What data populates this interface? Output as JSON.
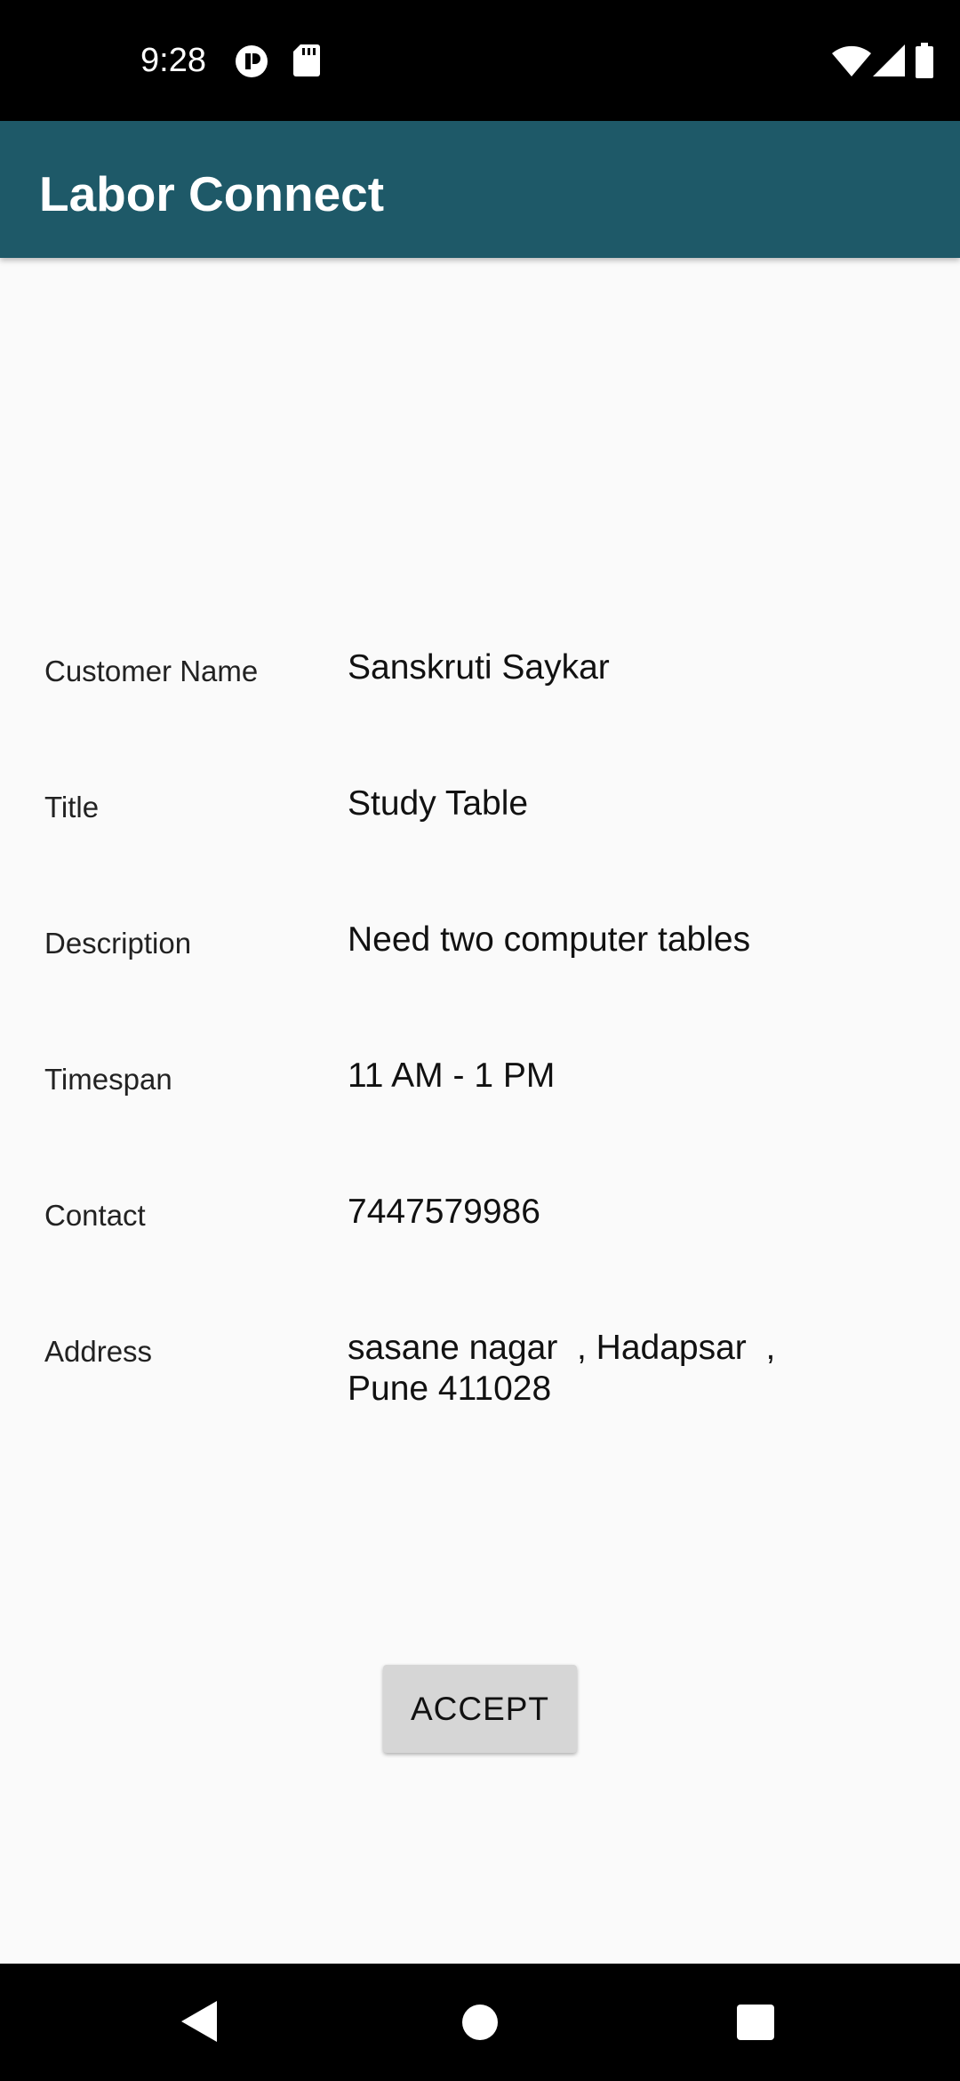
{
  "status_bar": {
    "time": "9:28",
    "icons_left": [
      "notification-icon",
      "sd-card-icon"
    ],
    "icons_right": [
      "wifi-icon",
      "signal-icon",
      "battery-icon"
    ]
  },
  "app_bar": {
    "title": "Labor Connect",
    "color": "#1e5968"
  },
  "details": {
    "customer_name": {
      "label": "Customer Name",
      "value": "Sanskruti Saykar"
    },
    "title": {
      "label": "Title",
      "value": "Study Table"
    },
    "description": {
      "label": "Description",
      "value": "Need two computer tables"
    },
    "timespan": {
      "label": "Timespan",
      "value": "11 AM - 1 PM"
    },
    "contact": {
      "label": "Contact",
      "value": "7447579986"
    },
    "address": {
      "label": "Address",
      "value_line1": "sasane nagar  , Hadapsar  ,",
      "value_line2": "Pune 411028"
    }
  },
  "actions": {
    "accept_label": "ACCEPT"
  },
  "nav_bar": {
    "buttons": [
      "back-icon",
      "home-icon",
      "recents-icon"
    ]
  }
}
